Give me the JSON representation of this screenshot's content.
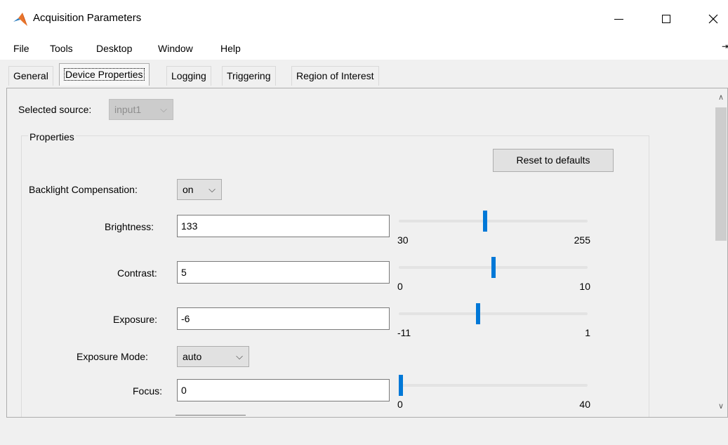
{
  "window": {
    "title": "Acquisition Parameters",
    "minimize": "—",
    "maximize": "☐",
    "close": "✕"
  },
  "menu": [
    "File",
    "Tools",
    "Desktop",
    "Window",
    "Help"
  ],
  "tabs": [
    "General",
    "Device Properties",
    "Logging",
    "Triggering",
    "Region of Interest"
  ],
  "active_tab": "Device Properties",
  "source": {
    "label": "Selected source:",
    "value": "input1"
  },
  "properties": {
    "group_title": "Properties",
    "reset_label": "Reset to defaults",
    "backlight": {
      "label": "Backlight Compensation:",
      "value": "on"
    },
    "brightness": {
      "label": "Brightness:",
      "value": "133",
      "min": "30",
      "max": "255",
      "level": 133
    },
    "contrast": {
      "label": "Contrast:",
      "value": "5",
      "min": "0",
      "max": "10",
      "level": 5
    },
    "exposure": {
      "label": "Exposure:",
      "value": "-6",
      "min": "-11",
      "max": "1",
      "level": -6
    },
    "exposure_mode": {
      "label": "Exposure Mode:",
      "value": "auto"
    },
    "focus": {
      "label": "Focus:",
      "value": "0",
      "min": "0",
      "max": "40",
      "level": 0
    }
  },
  "icons": {
    "chevron": "chevron-down-icon",
    "scroll_up": "∧",
    "scroll_down": "∨"
  },
  "colors": {
    "slider_thumb": "#0078d7"
  }
}
